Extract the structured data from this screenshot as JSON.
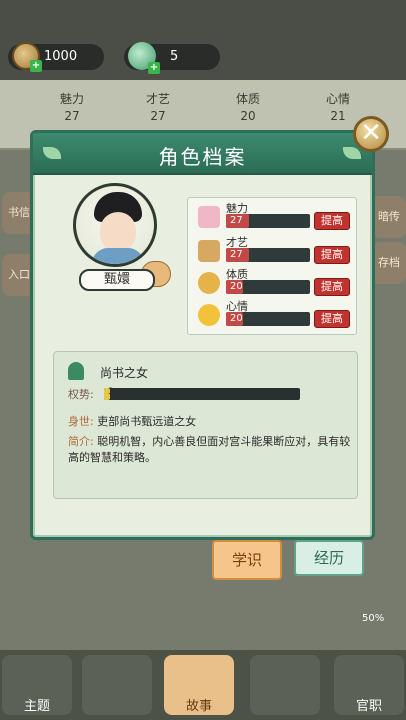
{
  "resources": {
    "coins": "1000",
    "gems": "5",
    "plus_glyph": "+"
  },
  "background_stats": [
    {
      "label": "魅力",
      "value": "27"
    },
    {
      "label": "才艺",
      "value": "27"
    },
    {
      "label": "体质",
      "value": "20"
    },
    {
      "label": "心情",
      "value": "21"
    }
  ],
  "side_buttons": {
    "left_top": "书信",
    "left_bottom": "入口",
    "right_top": "暗传",
    "right_bottom": "存档"
  },
  "modal": {
    "title": "角色档案",
    "close_glyph": "✕",
    "character_name": "甄嬛",
    "attributes": [
      {
        "name": "魅力",
        "value": "27",
        "fill": 0.27,
        "icon": "flower-icon",
        "button": "提高",
        "color": "#f0b7c8"
      },
      {
        "name": "才艺",
        "value": "27",
        "fill": 0.27,
        "icon": "scroll-icon",
        "button": "提高",
        "color": "#d6a862"
      },
      {
        "name": "体质",
        "value": "20",
        "fill": 0.2,
        "icon": "fist-icon",
        "button": "提高",
        "color": "#e6b24a"
      },
      {
        "name": "心情",
        "value": "20",
        "fill": 0.2,
        "icon": "smiley-icon",
        "button": "提高",
        "color": "#f2c23a"
      }
    ],
    "origin": "尚书之女",
    "power_label": "权势:",
    "power_value": "3",
    "power_fill": 0.03,
    "background_key": "身世:",
    "background_text": "吏部尚书甄远道之女",
    "intro_key": "简介:",
    "intro_text": "聪明机智，内心善良但面对宫斗能果断应对，具有较高的智慧和策略。"
  },
  "tabs": {
    "study": "学识",
    "experience": "经历"
  },
  "progress_percent": "50%",
  "bottom_nav": [
    {
      "label": "主题",
      "active": false
    },
    {
      "label": "",
      "active": false
    },
    {
      "label": "故事",
      "active": true
    },
    {
      "label": "",
      "active": false
    },
    {
      "label": "官职",
      "active": false
    }
  ],
  "colors": {
    "header_green": "#2c6c55",
    "up_button_red": "#c0332f",
    "study_tab": "#f6c58b"
  }
}
